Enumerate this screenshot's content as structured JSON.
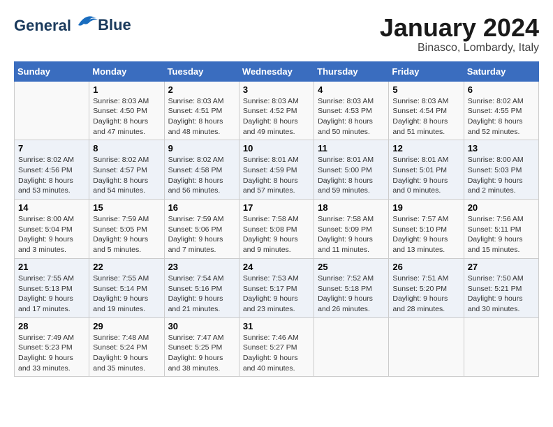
{
  "header": {
    "logo_line1": "General",
    "logo_line2": "Blue",
    "month_title": "January 2024",
    "location": "Binasco, Lombardy, Italy"
  },
  "columns": [
    "Sunday",
    "Monday",
    "Tuesday",
    "Wednesday",
    "Thursday",
    "Friday",
    "Saturday"
  ],
  "weeks": [
    [
      {
        "day": "",
        "info": ""
      },
      {
        "day": "1",
        "info": "Sunrise: 8:03 AM\nSunset: 4:50 PM\nDaylight: 8 hours\nand 47 minutes."
      },
      {
        "day": "2",
        "info": "Sunrise: 8:03 AM\nSunset: 4:51 PM\nDaylight: 8 hours\nand 48 minutes."
      },
      {
        "day": "3",
        "info": "Sunrise: 8:03 AM\nSunset: 4:52 PM\nDaylight: 8 hours\nand 49 minutes."
      },
      {
        "day": "4",
        "info": "Sunrise: 8:03 AM\nSunset: 4:53 PM\nDaylight: 8 hours\nand 50 minutes."
      },
      {
        "day": "5",
        "info": "Sunrise: 8:03 AM\nSunset: 4:54 PM\nDaylight: 8 hours\nand 51 minutes."
      },
      {
        "day": "6",
        "info": "Sunrise: 8:02 AM\nSunset: 4:55 PM\nDaylight: 8 hours\nand 52 minutes."
      }
    ],
    [
      {
        "day": "7",
        "info": "Sunrise: 8:02 AM\nSunset: 4:56 PM\nDaylight: 8 hours\nand 53 minutes."
      },
      {
        "day": "8",
        "info": "Sunrise: 8:02 AM\nSunset: 4:57 PM\nDaylight: 8 hours\nand 54 minutes."
      },
      {
        "day": "9",
        "info": "Sunrise: 8:02 AM\nSunset: 4:58 PM\nDaylight: 8 hours\nand 56 minutes."
      },
      {
        "day": "10",
        "info": "Sunrise: 8:01 AM\nSunset: 4:59 PM\nDaylight: 8 hours\nand 57 minutes."
      },
      {
        "day": "11",
        "info": "Sunrise: 8:01 AM\nSunset: 5:00 PM\nDaylight: 8 hours\nand 59 minutes."
      },
      {
        "day": "12",
        "info": "Sunrise: 8:01 AM\nSunset: 5:01 PM\nDaylight: 9 hours\nand 0 minutes."
      },
      {
        "day": "13",
        "info": "Sunrise: 8:00 AM\nSunset: 5:03 PM\nDaylight: 9 hours\nand 2 minutes."
      }
    ],
    [
      {
        "day": "14",
        "info": "Sunrise: 8:00 AM\nSunset: 5:04 PM\nDaylight: 9 hours\nand 3 minutes."
      },
      {
        "day": "15",
        "info": "Sunrise: 7:59 AM\nSunset: 5:05 PM\nDaylight: 9 hours\nand 5 minutes."
      },
      {
        "day": "16",
        "info": "Sunrise: 7:59 AM\nSunset: 5:06 PM\nDaylight: 9 hours\nand 7 minutes."
      },
      {
        "day": "17",
        "info": "Sunrise: 7:58 AM\nSunset: 5:08 PM\nDaylight: 9 hours\nand 9 minutes."
      },
      {
        "day": "18",
        "info": "Sunrise: 7:58 AM\nSunset: 5:09 PM\nDaylight: 9 hours\nand 11 minutes."
      },
      {
        "day": "19",
        "info": "Sunrise: 7:57 AM\nSunset: 5:10 PM\nDaylight: 9 hours\nand 13 minutes."
      },
      {
        "day": "20",
        "info": "Sunrise: 7:56 AM\nSunset: 5:11 PM\nDaylight: 9 hours\nand 15 minutes."
      }
    ],
    [
      {
        "day": "21",
        "info": "Sunrise: 7:55 AM\nSunset: 5:13 PM\nDaylight: 9 hours\nand 17 minutes."
      },
      {
        "day": "22",
        "info": "Sunrise: 7:55 AM\nSunset: 5:14 PM\nDaylight: 9 hours\nand 19 minutes."
      },
      {
        "day": "23",
        "info": "Sunrise: 7:54 AM\nSunset: 5:16 PM\nDaylight: 9 hours\nand 21 minutes."
      },
      {
        "day": "24",
        "info": "Sunrise: 7:53 AM\nSunset: 5:17 PM\nDaylight: 9 hours\nand 23 minutes."
      },
      {
        "day": "25",
        "info": "Sunrise: 7:52 AM\nSunset: 5:18 PM\nDaylight: 9 hours\nand 26 minutes."
      },
      {
        "day": "26",
        "info": "Sunrise: 7:51 AM\nSunset: 5:20 PM\nDaylight: 9 hours\nand 28 minutes."
      },
      {
        "day": "27",
        "info": "Sunrise: 7:50 AM\nSunset: 5:21 PM\nDaylight: 9 hours\nand 30 minutes."
      }
    ],
    [
      {
        "day": "28",
        "info": "Sunrise: 7:49 AM\nSunset: 5:23 PM\nDaylight: 9 hours\nand 33 minutes."
      },
      {
        "day": "29",
        "info": "Sunrise: 7:48 AM\nSunset: 5:24 PM\nDaylight: 9 hours\nand 35 minutes."
      },
      {
        "day": "30",
        "info": "Sunrise: 7:47 AM\nSunset: 5:25 PM\nDaylight: 9 hours\nand 38 minutes."
      },
      {
        "day": "31",
        "info": "Sunrise: 7:46 AM\nSunset: 5:27 PM\nDaylight: 9 hours\nand 40 minutes."
      },
      {
        "day": "",
        "info": ""
      },
      {
        "day": "",
        "info": ""
      },
      {
        "day": "",
        "info": ""
      }
    ]
  ]
}
